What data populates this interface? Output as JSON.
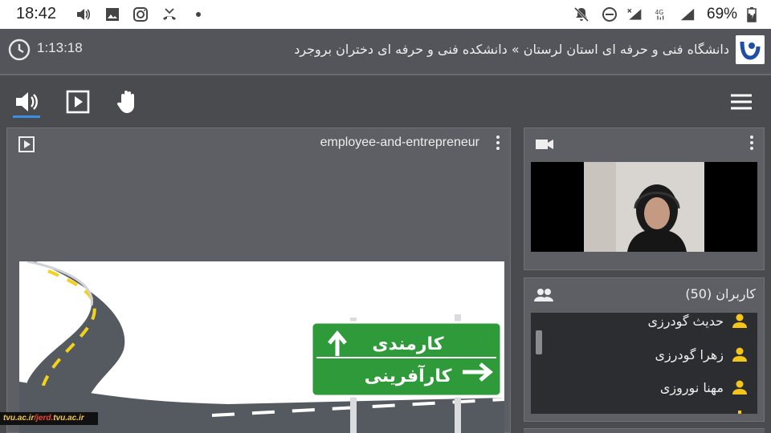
{
  "status_bar": {
    "time": "18:42",
    "battery_percent": "69%"
  },
  "header": {
    "elapsed_time": "1:13:18",
    "title": "دانشگاه فنی و حرفه ای استان لرستان » دانشکده فنی و حرفه ای دختران بروجرد"
  },
  "presentation": {
    "file_name": "employee-and-entrepreneur",
    "sign_top": "کارمندی",
    "sign_bottom": "کارآفرینی"
  },
  "users": {
    "heading": "کاربران (50)",
    "list": [
      {
        "name": "حدیث گودرزی"
      },
      {
        "name": "زهرا گودرزی"
      },
      {
        "name": "مهنا نوروزی"
      }
    ]
  },
  "watermark": {
    "part1": "tvu.ac.ir",
    "part2": "/jerd.",
    "part3": "tvu.ac.ir"
  },
  "colors": {
    "accent": "#3a8ee6",
    "user_icon": "#f5c518",
    "sign_green": "#2e9a3a"
  }
}
